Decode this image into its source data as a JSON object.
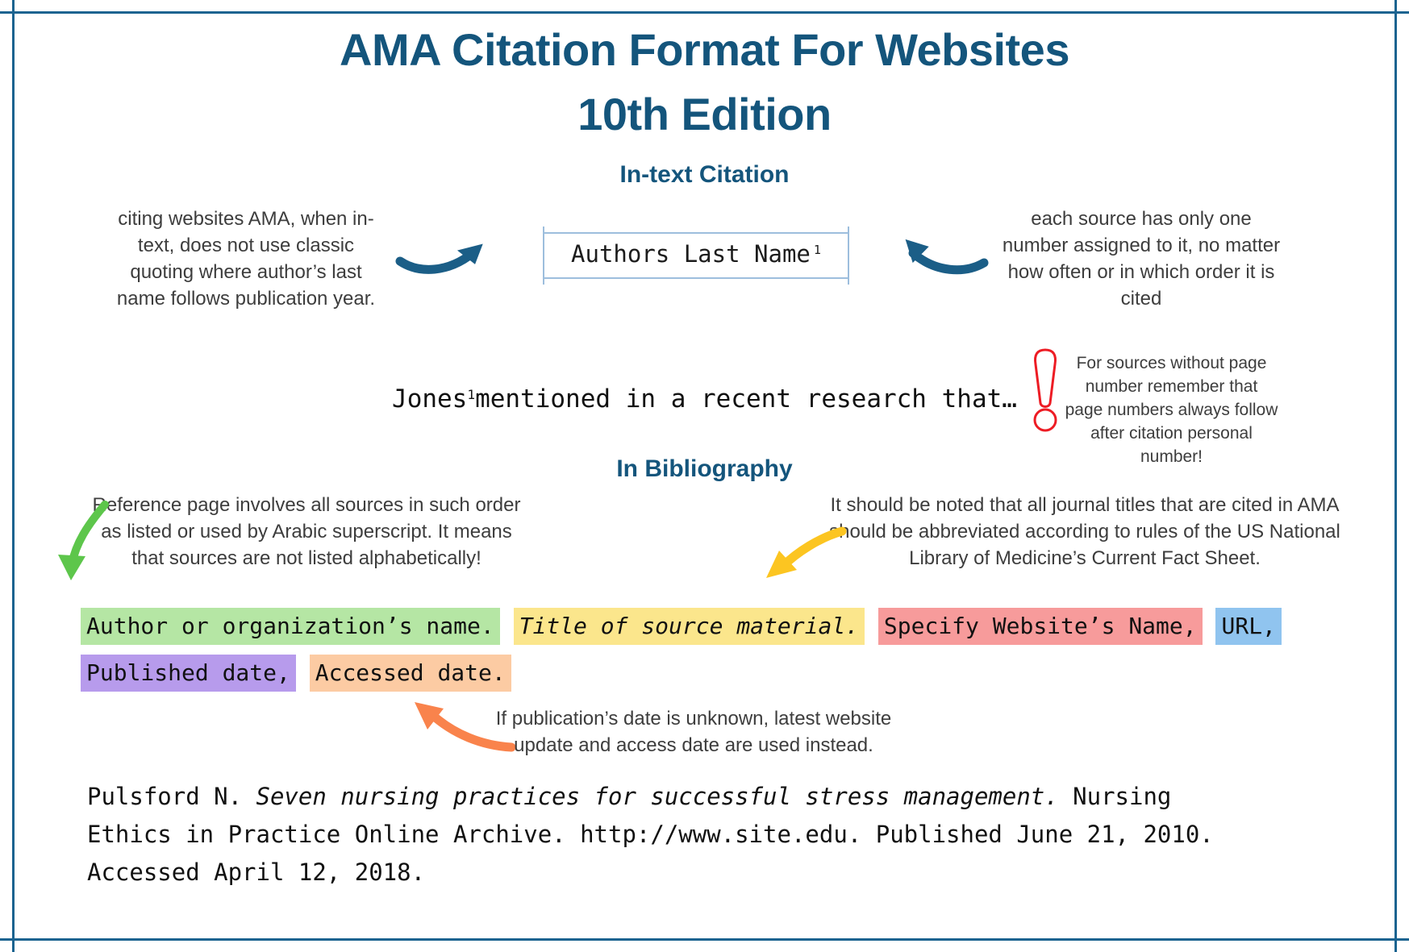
{
  "frame": {
    "color": "#1b6390"
  },
  "header": {
    "title_line1": "AMA Citation Format For Websites",
    "title_line2": "10th Edition",
    "title_color": "#14557C"
  },
  "sections": {
    "intext_heading": "In-text Citation",
    "bibliography_heading": "In Bibliography"
  },
  "intext": {
    "note_left": "citing websites AMA, when in-text, does not use classic quoting where author’s last name follows publication year.",
    "note_right": "each source has only one number assigned to it, no matter how often or in which order it is cited",
    "format_box": {
      "text": "Authors Last Name",
      "superscript": "1",
      "border_color": "#9dbedd"
    },
    "example_prefix": "Jones",
    "example_superscript": "1",
    "example_suffix": "mentioned in a recent research that…",
    "warning": {
      "icon": "exclamation-mark-icon",
      "icon_color": "#ED1C24",
      "text": "For sources without page number remember that page numbers always follow after citation personal number!"
    }
  },
  "bibliography": {
    "note_left": "Reference page involves all sources in such order as listed or used by Arabic superscript. It means that sources are not listed alphabetically!",
    "note_right": "It should be noted that all journal titles that are cited in AMA should be abbreviated according to rules of the US National Library of Medicine’s Current Fact Sheet.",
    "note_bottom": "If publication’s date is unknown, latest website update and access date are used instead.",
    "template_parts": [
      {
        "text": "Author or organization’s name.",
        "color": "#B5E6A4",
        "italic": false
      },
      {
        "text": "Title of source material.",
        "color": "#FBE68C",
        "italic": true
      },
      {
        "text": "Specify Website’s Name,",
        "color": "#F79B9B",
        "italic": false
      },
      {
        "text": "URL,",
        "color": "#90C4EF",
        "italic": false
      },
      {
        "text": "Published date,",
        "color": "#B79BEC",
        "italic": false
      },
      {
        "text": "Accessed date.",
        "color": "#FCCBA3",
        "italic": false
      }
    ],
    "example": {
      "part1": "Pulsford N. ",
      "part2_italic": "Seven nursing practices for successful stress management.",
      "part3": " Nursing Ethics in Practice Online Archive. http://www.site.edu. Published June 21, 2010. Accessed April 12, 2018."
    }
  },
  "arrows": [
    {
      "name": "arrow-to-format-box",
      "color": "#1B5E87"
    },
    {
      "name": "arrow-from-right-note",
      "color": "#1B5E87"
    },
    {
      "name": "arrow-green-down",
      "color": "#5DC64B"
    },
    {
      "name": "arrow-yellow-down-left",
      "color": "#FCC521"
    },
    {
      "name": "arrow-orange-up-left",
      "color": "#F9834C"
    }
  ]
}
